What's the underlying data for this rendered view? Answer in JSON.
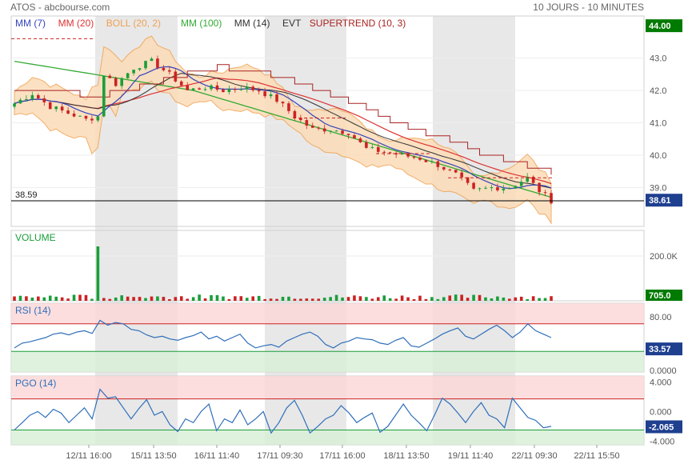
{
  "header": {
    "left": "ATOS - abcbourse.com",
    "right": "10 JOURS - 10 MINUTES"
  },
  "legend": [
    {
      "label": "MM (7)",
      "color": "#3344bb"
    },
    {
      "label": "MM (20)",
      "color": "#dd3333"
    },
    {
      "label": "BOLL (20, 2)",
      "color": "#f0a050"
    },
    {
      "label": "MM (100)",
      "color": "#33aa33"
    },
    {
      "label": "MM (14)",
      "color": "#333333"
    },
    {
      "label": "EVT",
      "color": "#333333"
    },
    {
      "label": "SUPERTREND (10, 3)",
      "color": "#aa2222"
    }
  ],
  "colors": {
    "up": "#1a9e3a",
    "down": "#cc2222",
    "shade": "#e6e6e6",
    "boll_fill": "#fbdcb8",
    "rsi_line": "#2f6fba",
    "pgo_line": "#2f6fba",
    "overbought": "#fbd6d6",
    "oversold": "#d6efd6",
    "current_badge": "#007a00"
  },
  "chart_data": [
    {
      "type": "candlestick",
      "name": "price",
      "ylim": [
        37.8,
        44.3
      ],
      "yticks": [
        "39.0",
        "40.0",
        "41.0",
        "42.0",
        "43.0"
      ],
      "ytick_values": [
        39,
        40,
        41,
        42,
        43
      ],
      "xticks": [
        "12/11 16:00",
        "15/11 13:50",
        "16/11 11:40",
        "17/11 09:30",
        "17/11 16:00",
        "18/11 13:50",
        "19/11 11:40",
        "22/11 09:30",
        "22/11 15:50"
      ],
      "high_badge": "44.00",
      "last_badge": "38.61",
      "hline_label": "38.59",
      "hline_value": 38.59,
      "close_path": [
        [
          0,
          41.6
        ],
        [
          3,
          41.9
        ],
        [
          6,
          41.5
        ],
        [
          9,
          41.3
        ],
        [
          12,
          41.1
        ],
        [
          14,
          41.2
        ],
        [
          15,
          42.5
        ],
        [
          17,
          42.2
        ],
        [
          20,
          42.7
        ],
        [
          23,
          42.9
        ],
        [
          26,
          42.5
        ],
        [
          29,
          42.0
        ],
        [
          32,
          42.1
        ],
        [
          35,
          42.0
        ],
        [
          38,
          42.1
        ],
        [
          41,
          42.0
        ],
        [
          44,
          41.7
        ],
        [
          47,
          41.2
        ],
        [
          50,
          40.8
        ],
        [
          53,
          40.8
        ],
        [
          56,
          40.7
        ],
        [
          59,
          40.2
        ],
        [
          62,
          40.1
        ],
        [
          65,
          40.0
        ],
        [
          68,
          39.9
        ],
        [
          71,
          39.7
        ],
        [
          74,
          39.4
        ],
        [
          77,
          38.9
        ],
        [
          80,
          39.0
        ],
        [
          83,
          39.0
        ],
        [
          86,
          39.3
        ],
        [
          88,
          38.9
        ],
        [
          90,
          38.6
        ]
      ]
    },
    {
      "type": "bar",
      "name": "volume",
      "title": "VOLUME",
      "yticks": [
        "200.0K"
      ],
      "last_badge": "705.0",
      "spike_index": 14
    },
    {
      "type": "line",
      "name": "rsi",
      "title": "RSI (14)",
      "ylim": [
        0,
        100
      ],
      "yticks": [
        "80.00",
        "0.0000"
      ],
      "upper": 70,
      "lower": 30,
      "last_badge": "33.57",
      "values": [
        35,
        42,
        44,
        47,
        50,
        55,
        57,
        54,
        58,
        60,
        56,
        75,
        68,
        72,
        70,
        62,
        60,
        54,
        50,
        52,
        48,
        46,
        50,
        53,
        58,
        48,
        52,
        45,
        50,
        55,
        42,
        35,
        38,
        40,
        36,
        45,
        50,
        55,
        58,
        52,
        40,
        35,
        42,
        45,
        50,
        48,
        47,
        42,
        40,
        46,
        50,
        38,
        36,
        42,
        48,
        55,
        60,
        64,
        52,
        48,
        55,
        62,
        68,
        60,
        50,
        58,
        70,
        60,
        55,
        50
      ]
    },
    {
      "type": "line",
      "name": "pgo",
      "title": "PGO (14)",
      "ylim": [
        -4.5,
        4.8
      ],
      "yticks": [
        "4.000",
        "0.000",
        "-4.000"
      ],
      "upper": 1.7,
      "lower": -2.5,
      "last_badge": "-2.065",
      "values": [
        -2.5,
        -1.5,
        -0.5,
        0.0,
        -0.8,
        0.3,
        -0.2,
        -1.5,
        -0.5,
        0.5,
        -1.0,
        3.0,
        1.8,
        2.0,
        0.5,
        -1.0,
        0.4,
        1.6,
        -0.5,
        0.0,
        -1.8,
        -2.7,
        -1.0,
        -1.5,
        0.0,
        1.0,
        -2.6,
        -1.0,
        -1.5,
        0.2,
        -1.8,
        -1.0,
        0.0,
        -2.9,
        -1.5,
        0.5,
        1.5,
        -0.5,
        -2.9,
        -2.0,
        -1.0,
        -0.5,
        0.8,
        -0.2,
        -1.5,
        -0.8,
        -0.2,
        -2.8,
        -2.0,
        -0.5,
        1.0,
        -0.5,
        -1.5,
        -2.6,
        -0.5,
        1.8,
        1.0,
        -0.2,
        -1.5,
        0.0,
        1.2,
        -0.5,
        -1.0,
        -2.2,
        1.8,
        0.5,
        -0.8,
        -1.2,
        -2.2,
        -2.0
      ]
    }
  ]
}
